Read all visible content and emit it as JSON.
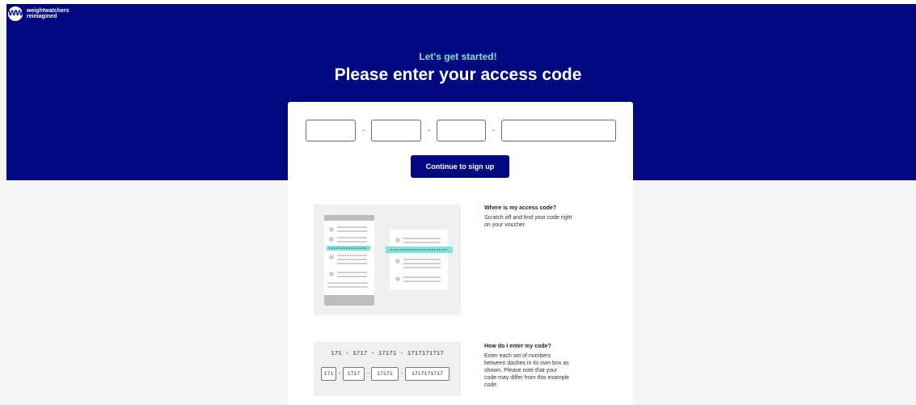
{
  "brand": {
    "line1": "weightwatchers",
    "line2": "reimagined",
    "mark": "WW"
  },
  "header": {
    "subtitle": "Let's get started!",
    "title": "Please enter your access code"
  },
  "form": {
    "dash": "-",
    "continue_label": "Continue to sign up"
  },
  "help": [
    {
      "title": "Where is my access code?",
      "body": "Scratch off and find your code right on your voucher."
    },
    {
      "title": "How do I enter my code?",
      "body": "Enter each set of numbers between dashes in its own box as shown. Please note that your code may differ from this example code."
    }
  ],
  "example": {
    "code_line": "171 - 1717 - 17171 - 1717171717",
    "parts": [
      "171",
      "1717",
      "17171",
      "1717171717"
    ],
    "dash": "-"
  },
  "colors": {
    "brand_navy": "#000880",
    "accent_teal": "#7fe3da",
    "page_bg": "#f5f5f5"
  }
}
